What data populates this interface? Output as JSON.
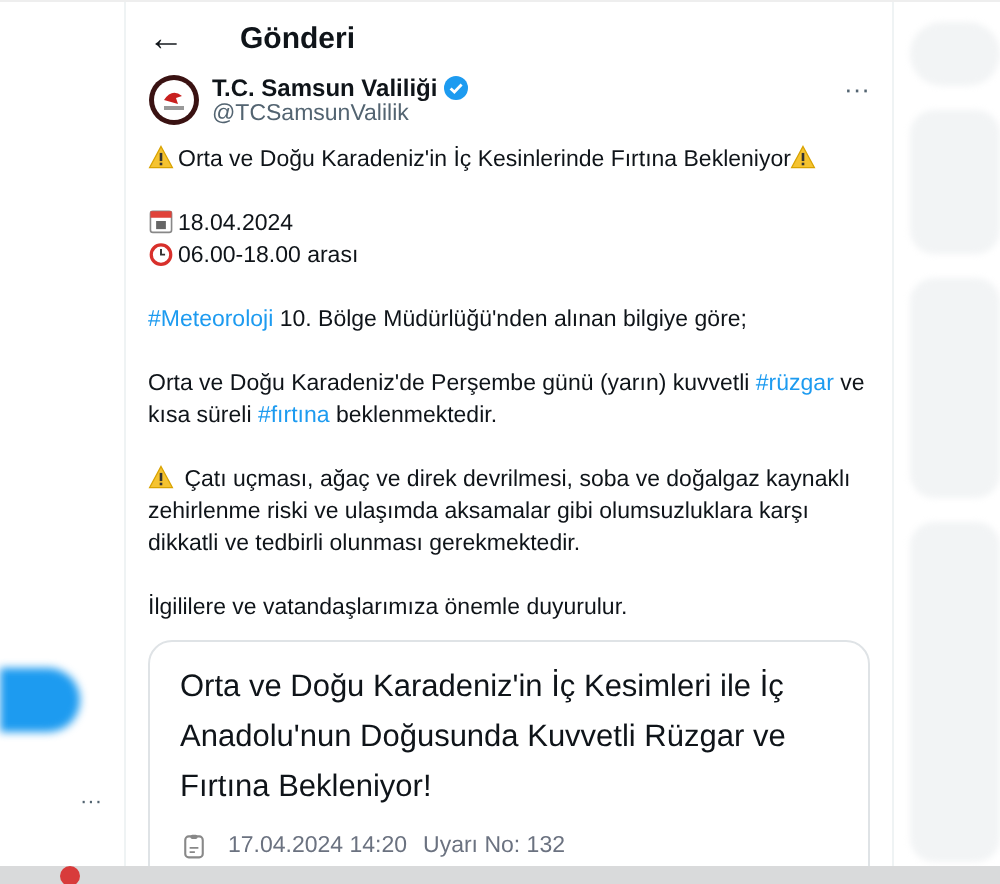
{
  "header": {
    "back": "←",
    "title": "Gönderi"
  },
  "post": {
    "author": "T.C. Samsun Valiliği",
    "verified": true,
    "handle": "@TCSamsunValilik",
    "more": "···",
    "lines": [
      {
        "kind": "warning_title",
        "segments": [
          {
            "kind": "plain",
            "text": "Orta ve Doğu Karadeniz'in İç Kesinlerinde Fırtına Bekleniyor"
          }
        ]
      },
      {
        "kind": "spacer"
      },
      {
        "kind": "date",
        "segments": [
          {
            "kind": "plain",
            "text": "18.04.2024"
          }
        ]
      },
      {
        "kind": "time",
        "segments": [
          {
            "kind": "plain",
            "text": "06.00-18.00 arası"
          }
        ]
      },
      {
        "kind": "spacer"
      },
      {
        "kind": "text",
        "segments": [
          {
            "kind": "hashtag",
            "text": "#Meteoroloji"
          },
          {
            "kind": "plain",
            "text": " 10. Bölge Müdürlüğü'nden alınan bilgiye göre;"
          }
        ]
      },
      {
        "kind": "spacer"
      },
      {
        "kind": "text",
        "segments": [
          {
            "kind": "plain",
            "text": "Orta ve Doğu Karadeniz'de Perşembe günü (yarın) kuvvetli "
          },
          {
            "kind": "hashtag",
            "text": "#rüzgar"
          },
          {
            "kind": "plain",
            "text": " ve kısa süreli "
          },
          {
            "kind": "hashtag",
            "text": "#fırtına"
          },
          {
            "kind": "plain",
            "text": " beklenmektedir."
          }
        ]
      },
      {
        "kind": "spacer"
      },
      {
        "kind": "warning_text",
        "segments": [
          {
            "kind": "plain",
            "text": "Çatı uçması, ağaç ve direk devrilmesi, soba ve doğalgaz kaynaklı zehirlenme riski ve ulaşımda aksamalar gibi olumsuzluklara karşı dikkatli ve tedbirli olunması gerekmektedir."
          }
        ]
      },
      {
        "kind": "spacer"
      },
      {
        "kind": "text",
        "segments": [
          {
            "kind": "plain",
            "text": "İlgililere ve vatandaşlarımıza önemle duyurulur."
          }
        ]
      }
    ],
    "card": {
      "title": "Orta ve Doğu Karadeniz'in İç Kesimleri ile İç Anadolu'nun Doğusunda Kuvvetli Rüzgar ve Fırtına Bekleniyor!",
      "date": "17.04.2024 14:20",
      "warning_no": "Uyarı No: 132"
    }
  },
  "left_nav": {
    "more": "···"
  }
}
